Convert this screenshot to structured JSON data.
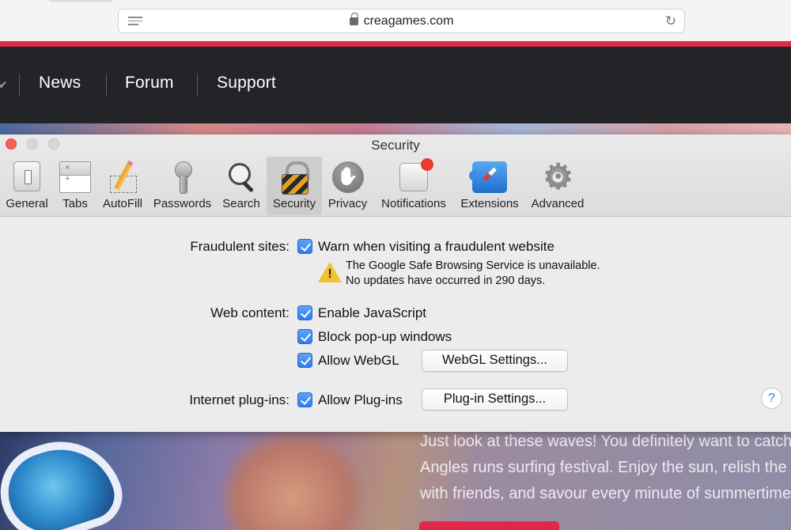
{
  "browser": {
    "url": "creagames.com",
    "icons": {
      "reader": "reader-view-icon",
      "lock": "lock-icon",
      "reload": "reload-icon"
    }
  },
  "site": {
    "nav": [
      "News",
      "Forum",
      "Support"
    ],
    "hero_lines": [
      "Just look at these waves! You definitely want to catch t",
      "Angles runs surfing festival. Enjoy the sun, relish the s",
      "with friends, and savour every minute of summertime"
    ],
    "accent_color": "#e0294a"
  },
  "prefs": {
    "title": "Security",
    "toolbar": [
      {
        "label": "General",
        "icon": "general-switch-icon"
      },
      {
        "label": "Tabs",
        "icon": "tabs-icon"
      },
      {
        "label": "AutoFill",
        "icon": "autofill-pencil-icon"
      },
      {
        "label": "Passwords",
        "icon": "key-icon"
      },
      {
        "label": "Search",
        "icon": "magnifier-icon"
      },
      {
        "label": "Security",
        "icon": "padlock-icon",
        "selected": true
      },
      {
        "label": "Privacy",
        "icon": "hand-icon"
      },
      {
        "label": "Notifications",
        "icon": "notification-badge-icon"
      },
      {
        "label": "Extensions",
        "icon": "compass-puzzle-icon"
      },
      {
        "label": "Advanced",
        "icon": "gear-icon"
      }
    ],
    "fraudulent": {
      "label": "Fraudulent sites:",
      "checkbox": "Warn when visiting a fraudulent website",
      "checked": true,
      "warning_line1": "The Google Safe Browsing Service is unavailable.",
      "warning_line2": "No updates have occurred in 290 days."
    },
    "web_content": {
      "label": "Web content:",
      "js": "Enable JavaScript",
      "popups": "Block pop-up windows",
      "webgl": "Allow WebGL",
      "webgl_button": "WebGL Settings..."
    },
    "plugins": {
      "label": "Internet plug-ins:",
      "checkbox": "Allow Plug-ins",
      "button": "Plug-in Settings..."
    },
    "help": "?",
    "checkbox_color": "#2f7cf0"
  }
}
